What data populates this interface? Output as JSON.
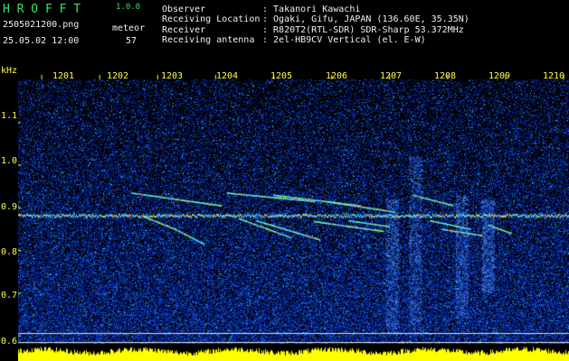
{
  "header": {
    "app_name": "H R O F F T",
    "version": "1.0.0",
    "filename": "2505021200.png",
    "datetime": "25.05.02 12:00",
    "meteor_label": "meteor",
    "meteor_count": "57"
  },
  "info": [
    {
      "label": "Observer",
      "value": ": Takanori Kawachi"
    },
    {
      "label": "Receiving Location",
      "value": ": Ogaki, Gifu, JAPAN (136.60E, 35.35N)"
    },
    {
      "label": "Receiver",
      "value": ": R820T2(RTL-SDR) SDR-Sharp 53.372MHz"
    },
    {
      "label": "Receiving antenna",
      "value": ": 2el-HB9CV Vertical (el. E-W)"
    }
  ],
  "chart_data": {
    "type": "heatmap",
    "ylabel": "kHz",
    "y_ticks": [
      "1.1",
      "1.0",
      "0.9",
      "0.8",
      "0.7",
      "0.6"
    ],
    "x_ticks": [
      "1201",
      "1202",
      "1203",
      "1204",
      "1205",
      "1206",
      "1207",
      "1208",
      "1209",
      "1210"
    ],
    "ylim": [
      0.58,
      1.2
    ],
    "xlim": [
      1200.6,
      1210.1
    ],
    "carrier_khz": 0.882,
    "meteor_traces": [
      {
        "t0": 1202.55,
        "f0": 0.935,
        "t1": 1204.1,
        "f1": 0.905
      },
      {
        "t0": 1202.75,
        "f0": 0.88,
        "t1": 1203.3,
        "f1": 0.85
      },
      {
        "t0": 1203.3,
        "f0": 0.85,
        "t1": 1203.8,
        "f1": 0.815
      },
      {
        "t0": 1204.2,
        "f0": 0.935,
        "t1": 1205.7,
        "f1": 0.915
      },
      {
        "t0": 1205.0,
        "f0": 0.93,
        "t1": 1206.5,
        "f1": 0.905
      },
      {
        "t0": 1205.9,
        "f0": 0.915,
        "t1": 1207.1,
        "f1": 0.89
      },
      {
        "t0": 1207.4,
        "f0": 0.93,
        "t1": 1208.1,
        "f1": 0.905
      },
      {
        "t0": 1204.4,
        "f0": 0.875,
        "t1": 1205.3,
        "f1": 0.83
      },
      {
        "t0": 1204.7,
        "f0": 0.87,
        "t1": 1205.8,
        "f1": 0.825
      },
      {
        "t0": 1205.7,
        "f0": 0.868,
        "t1": 1206.9,
        "f1": 0.845
      },
      {
        "t0": 1206.3,
        "f0": 0.87,
        "t1": 1207.0,
        "f1": 0.856
      },
      {
        "t0": 1207.7,
        "f0": 0.87,
        "t1": 1208.4,
        "f1": 0.85
      },
      {
        "t0": 1207.9,
        "f0": 0.85,
        "t1": 1208.6,
        "f1": 0.835
      },
      {
        "t0": 1208.7,
        "f0": 0.86,
        "t1": 1209.1,
        "f1": 0.84
      }
    ],
    "vertical_bursts": [
      {
        "t": 1207.05,
        "f_low": 0.6,
        "f_high": 0.92
      },
      {
        "t": 1207.45,
        "f_low": 0.6,
        "f_high": 1.02
      },
      {
        "t": 1208.25,
        "f_low": 0.64,
        "f_high": 0.93
      },
      {
        "t": 1208.7,
        "f_low": 0.7,
        "f_high": 0.92
      }
    ],
    "colors": {
      "background": "#000000",
      "noise_base": "#0a1aa0",
      "noise_bright": "#3a86ff",
      "trace": "#40e0ff",
      "trace_hot": "#ff5040",
      "carrier": "#ffd040",
      "power_bar": "#ffff00",
      "axis_text": "#ffff40"
    }
  }
}
